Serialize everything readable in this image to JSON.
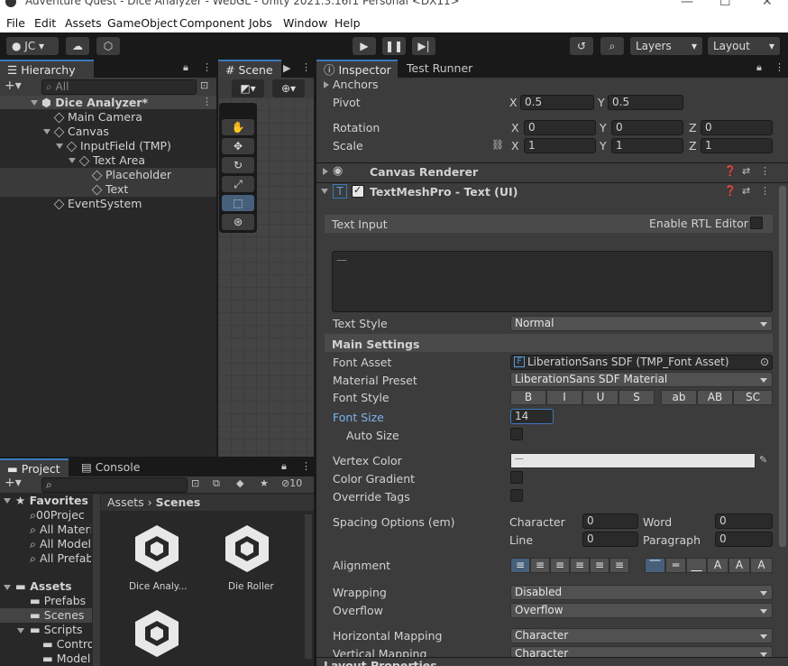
{
  "title_bar": {
    "text": "Adventure Quest - Dice Analyzer - WebGL - Unity 2021.3.16f1 Personal <DX11>"
  },
  "menu": [
    "File",
    "Edit",
    "Assets",
    "GameObject",
    "Component",
    "Jobs",
    "Window",
    "Help"
  ],
  "toolbar": {
    "account": "JC",
    "layers": "Layers",
    "layout": "Layout"
  },
  "hierarchy": {
    "tab": "Hierarchy",
    "search_placeholder": "All",
    "items": [
      {
        "label": "Dice Analyzer*"
      },
      {
        "label": "Main Camera"
      },
      {
        "label": "Canvas"
      },
      {
        "label": "InputField (TMP)"
      },
      {
        "label": "Text Area"
      },
      {
        "label": "Placeholder"
      },
      {
        "label": "Text"
      },
      {
        "label": "EventSystem"
      }
    ]
  },
  "scene": {
    "tab": "Scene"
  },
  "project": {
    "tabs": [
      "Project",
      "Console"
    ],
    "hidden_count": "10",
    "favorites_label": "Favorites",
    "favorites": [
      "00Projec",
      "All Materi",
      "All Model",
      "All Prefab"
    ],
    "assets_label": "Assets",
    "folders": [
      "Prefabs",
      "Scenes",
      "Scripts",
      "Contro",
      "Model"
    ],
    "breadcrumb": [
      "Assets",
      "Scenes"
    ],
    "files": [
      "Dice Analy...",
      "Die Roller"
    ]
  },
  "inspector": {
    "tabs": [
      "Inspector",
      "Test Runner"
    ],
    "anchors": "Anchors",
    "pivot": {
      "label": "Pivot",
      "x": "0.5",
      "y": "0.5"
    },
    "rotation": {
      "label": "Rotation",
      "x": "0",
      "y": "0",
      "z": "0"
    },
    "scale": {
      "label": "Scale",
      "x": "1",
      "y": "1",
      "z": "1"
    },
    "axes": {
      "x": "X",
      "y": "Y",
      "z": "Z"
    },
    "canvas_renderer": "Canvas Renderer",
    "tmp_title": "TextMeshPro - Text (UI)",
    "text_input": "Text Input",
    "enable_rtl": "Enable RTL Editor",
    "text_style": {
      "label": "Text Style",
      "value": "Normal"
    },
    "main_settings": "Main Settings",
    "font_asset": {
      "label": "Font Asset",
      "value": "LiberationSans SDF (TMP_Font Asset)"
    },
    "material_preset": {
      "label": "Material Preset",
      "value": "LiberationSans SDF Material"
    },
    "font_style": {
      "label": "Font Style",
      "buttons": [
        "B",
        "I",
        "U",
        "S",
        "ab",
        "AB",
        "SC"
      ]
    },
    "font_size": {
      "label": "Font Size",
      "value": "14"
    },
    "auto_size": "Auto Size",
    "vertex_color": "Vertex Color",
    "color_gradient": "Color Gradient",
    "override_tags": "Override Tags",
    "spacing": {
      "label": "Spacing Options (em)",
      "character": "Character",
      "character_val": "0",
      "word": "Word",
      "word_val": "0",
      "line": "Line",
      "line_val": "0",
      "paragraph": "Paragraph",
      "paragraph_val": "0"
    },
    "alignment": "Alignment",
    "wrapping": {
      "label": "Wrapping",
      "value": "Disabled"
    },
    "overflow": {
      "label": "Overflow",
      "value": "Overflow"
    },
    "h_mapping": {
      "label": "Horizontal Mapping",
      "value": "Character"
    },
    "v_mapping": {
      "label": "Vertical Mapping",
      "value": "Character"
    },
    "layout_props": "Layout Properties"
  }
}
